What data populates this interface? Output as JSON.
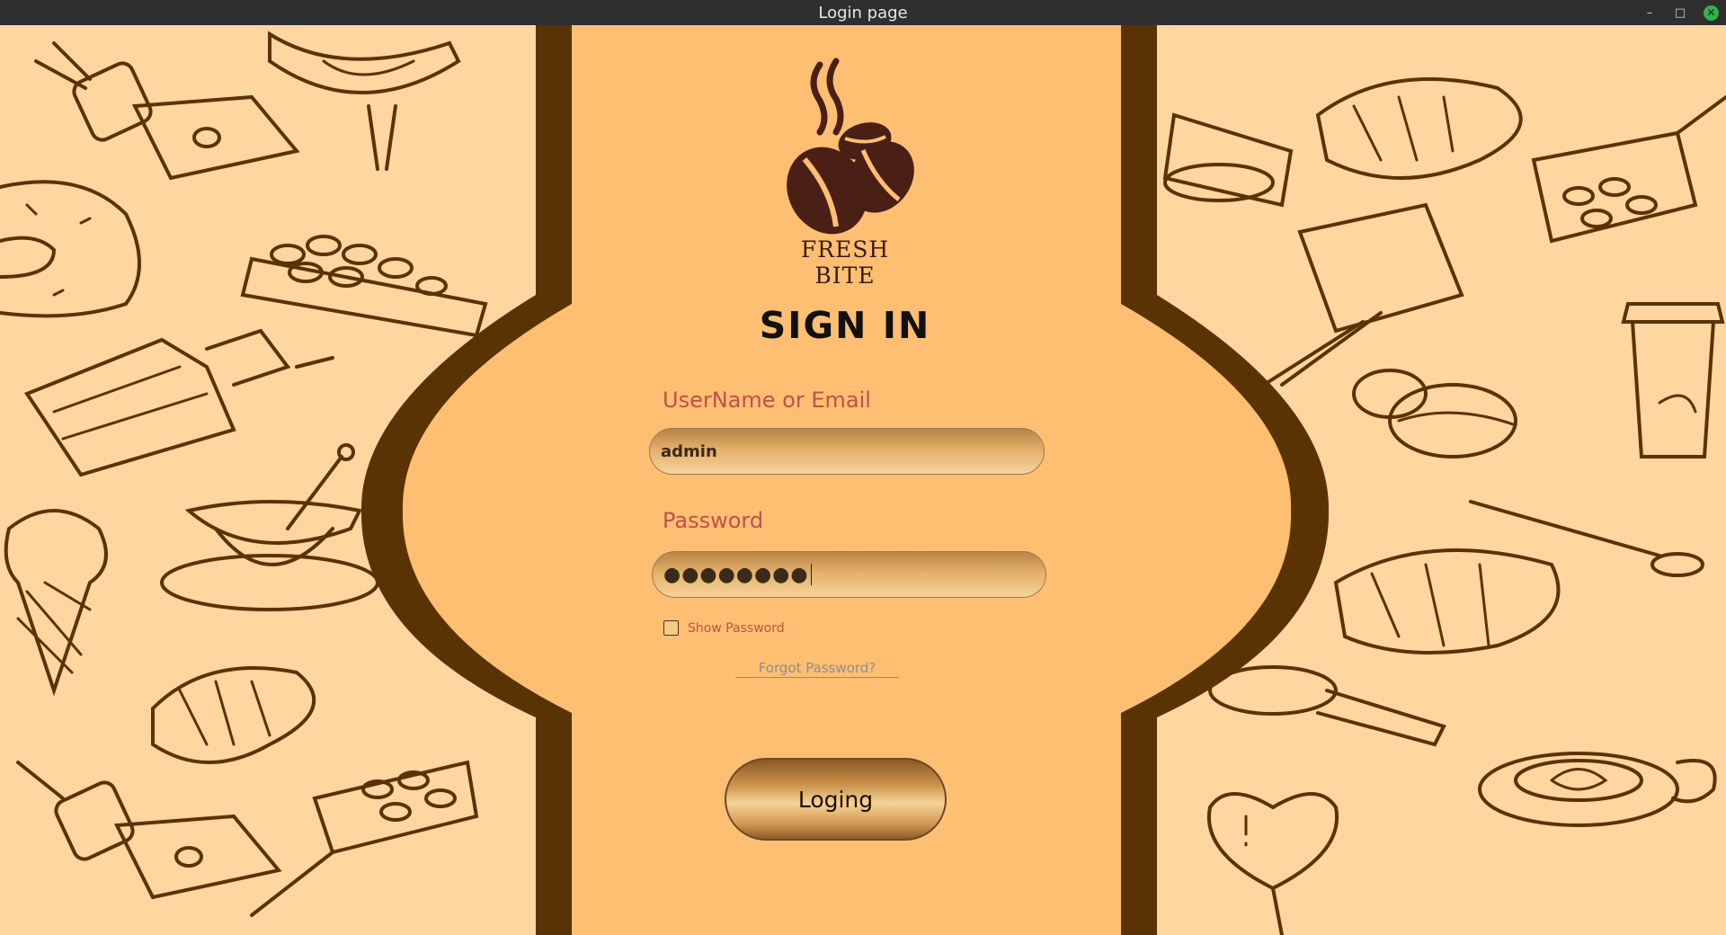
{
  "window": {
    "title": "Login page",
    "controls": {
      "minimize": "–",
      "maximize": "□",
      "close": "✕"
    }
  },
  "brand": {
    "name": "FRESH  BITE",
    "logo_icon": "coffee-beans-steam-icon"
  },
  "form": {
    "heading": "SIGN IN",
    "username_label": "UserName or Email",
    "username_value": "admin",
    "password_label": "Password",
    "password_value": "●●●●●●●●",
    "show_password_label": "Show Password",
    "show_password_checked": false,
    "forgot_label": "Forgot Password?",
    "login_label": "Loging"
  },
  "colors": {
    "background": "#ffd9a6",
    "panel": "#ffbf72",
    "frame": "#5a3304",
    "label": "#c0504a",
    "sketch": "#5a3304"
  }
}
